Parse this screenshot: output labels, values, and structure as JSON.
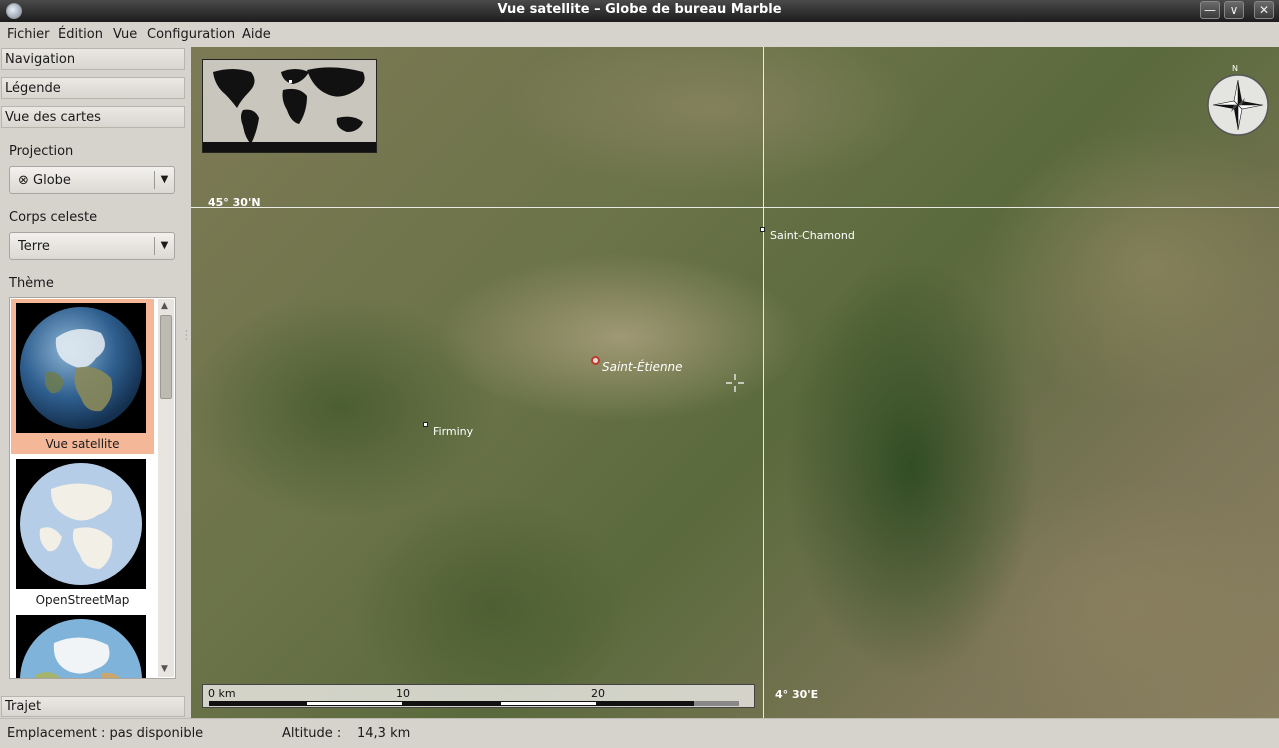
{
  "window": {
    "title": "Vue satellite – Globe de bureau Marble"
  },
  "menu": [
    "Fichier",
    "Édition",
    "Vue",
    "Configuration",
    "Aide"
  ],
  "sidebar": {
    "sections": {
      "navigation": "Navigation",
      "legend": "Légende",
      "map_view": "Vue des cartes",
      "route": "Trajet"
    },
    "projection": {
      "label": "Projection",
      "value": "Globe"
    },
    "celestial_body": {
      "label": "Corps celeste",
      "value": "Terre"
    },
    "theme": {
      "label": "Thème",
      "items": [
        {
          "name": "Vue satellite",
          "selected": true
        },
        {
          "name": "OpenStreetMap",
          "selected": false
        },
        {
          "name": "",
          "selected": false
        }
      ]
    }
  },
  "map": {
    "latitude_label": "45° 30'N",
    "longitude_label": "4° 30'E",
    "places": [
      {
        "name": "Saint-Chamond",
        "kind": "town"
      },
      {
        "name": "Saint-Étienne",
        "kind": "major"
      },
      {
        "name": "Firminy",
        "kind": "town"
      }
    ],
    "scale": {
      "ticks": [
        "0 km",
        "10",
        "20"
      ]
    },
    "compass_north": "N"
  },
  "status": {
    "location": "Emplacement : pas disponible",
    "altitude_label": "Altitude :",
    "altitude_value": "14,3 km"
  },
  "colors": {
    "selected_theme": "#f4b899",
    "city_marker": "#c0392b"
  }
}
